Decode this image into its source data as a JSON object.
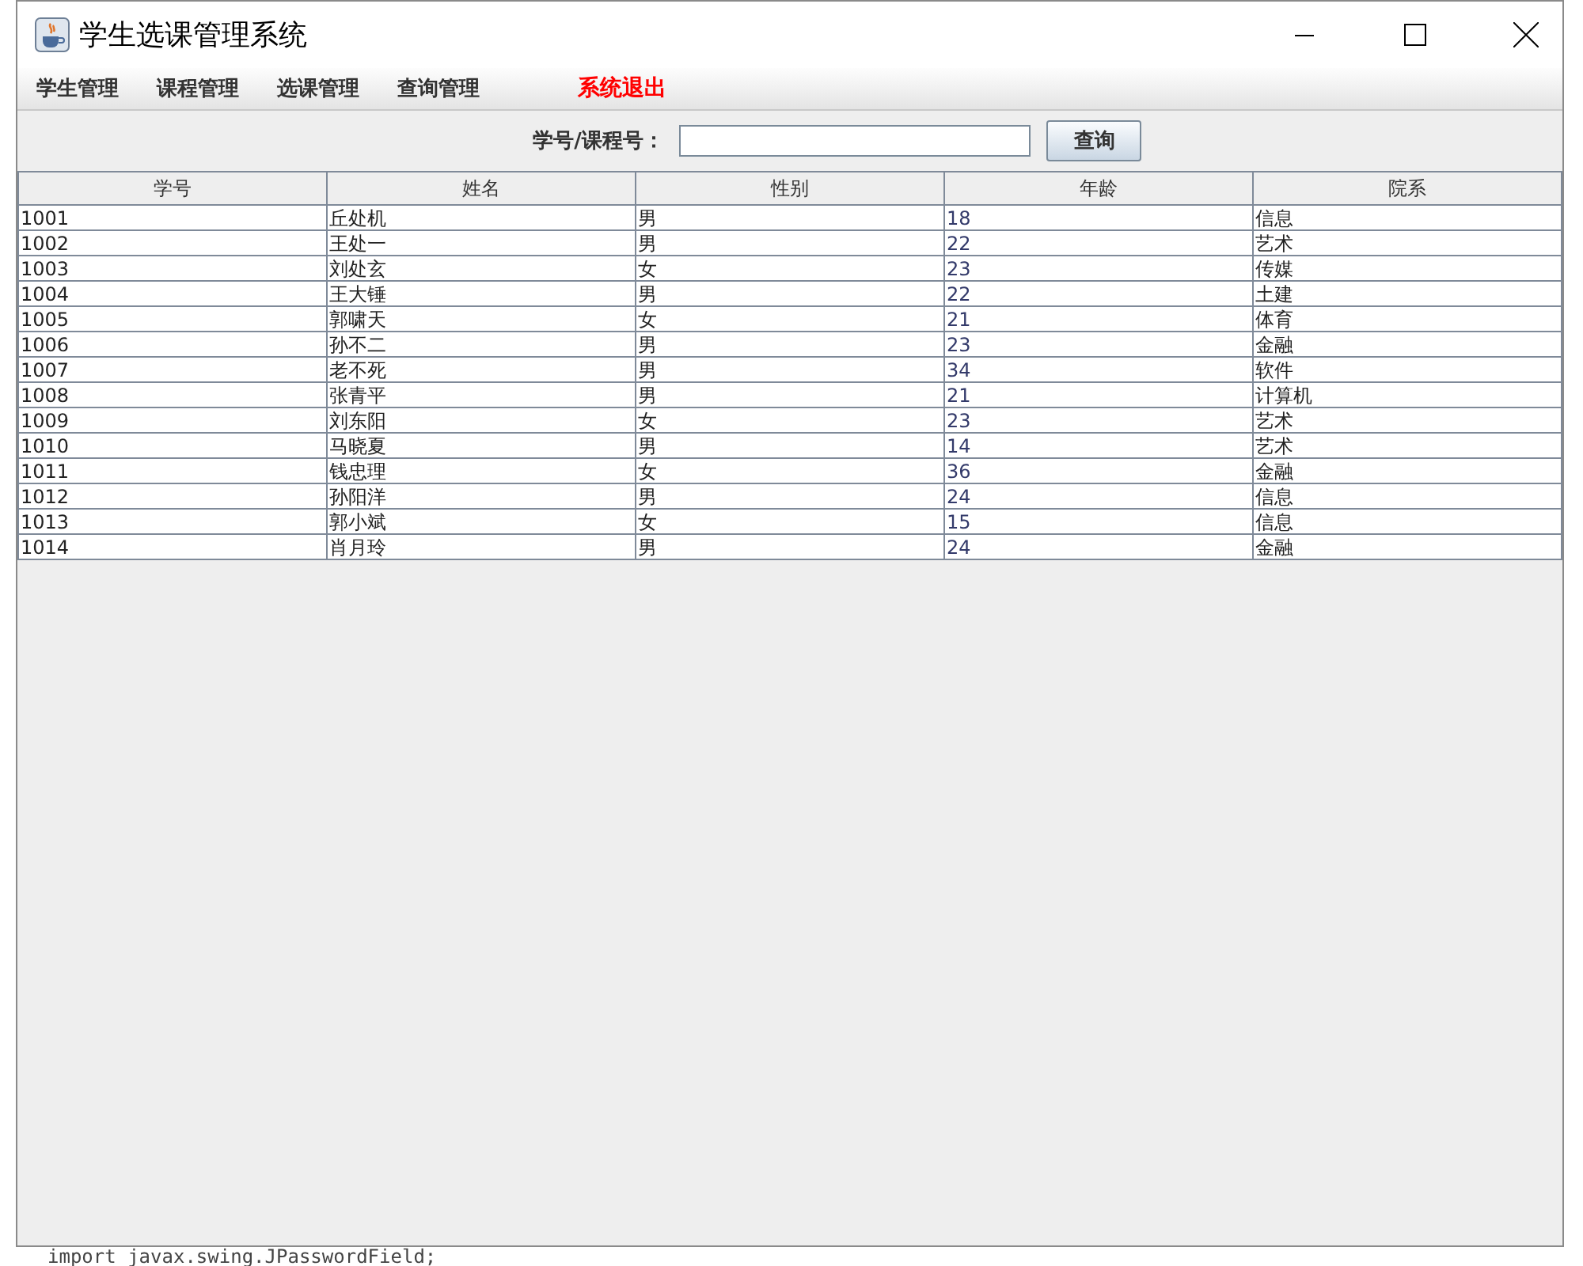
{
  "window": {
    "title": "学生选课管理系统"
  },
  "menu": [
    {
      "label": "学生管理",
      "kind": "menu"
    },
    {
      "label": "课程管理",
      "kind": "menu"
    },
    {
      "label": "选课管理",
      "kind": "menu"
    },
    {
      "label": "查询管理",
      "kind": "menu"
    },
    {
      "label": "系统退出",
      "kind": "exit"
    }
  ],
  "search": {
    "label": "学号/课程号：",
    "button": "查询"
  },
  "table": {
    "columns": [
      "学号",
      "姓名",
      "性别",
      "年龄",
      "院系"
    ],
    "rows": [
      [
        "1001",
        "丘处机",
        "男",
        "18",
        "信息"
      ],
      [
        "1002",
        "王处一",
        "男",
        "22",
        "艺术"
      ],
      [
        "1003",
        "刘处玄",
        "女",
        "23",
        "传媒"
      ],
      [
        "1004",
        "王大锤",
        "男",
        "22",
        "土建"
      ],
      [
        "1005",
        "郭啸天",
        "女",
        "21",
        "体育"
      ],
      [
        "1006",
        "孙不二",
        "男",
        "23",
        "金融"
      ],
      [
        "1007",
        "老不死",
        "男",
        "34",
        "软件"
      ],
      [
        "1008",
        "张青平",
        "男",
        "21",
        "计算机"
      ],
      [
        "1009",
        "刘东阳",
        "女",
        "23",
        "艺术"
      ],
      [
        "1010",
        "马晓夏",
        "男",
        "14",
        "艺术"
      ],
      [
        "1011",
        "钱忠理",
        "女",
        "36",
        "金融"
      ],
      [
        "1012",
        "孙阳洋",
        "男",
        "24",
        "信息"
      ],
      [
        "1013",
        "郭小斌",
        "女",
        "15",
        "信息"
      ],
      [
        "1014",
        "肖月玲",
        "男",
        "24",
        "金融"
      ]
    ]
  },
  "background_code": "import javax.swing.JPasswordField;"
}
